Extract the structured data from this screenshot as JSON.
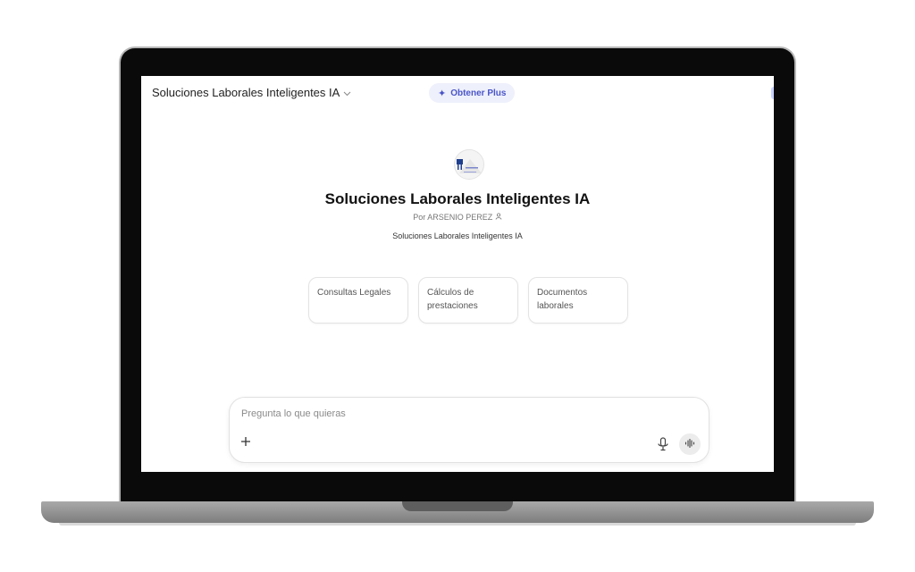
{
  "header": {
    "title": "Soluciones Laborales Inteligentes IA",
    "chevron": "chevron-down-icon",
    "plus_label": "Obtener Plus"
  },
  "profile": {
    "name": "Soluciones Laborales Inteligentes IA",
    "author": "Por ARSENIO PEREZ",
    "description": "Soluciones Laborales Inteligentes IA",
    "logo_icon": "gpt-logo"
  },
  "suggestions": [
    {
      "label": "Consultas Legales"
    },
    {
      "label": "Cálculos de prestaciones"
    },
    {
      "label": "Documentos laborales"
    }
  ],
  "composer": {
    "placeholder": "Pregunta lo que quieras",
    "add_icon": "plus-icon",
    "mic_icon": "microphone-icon",
    "voice_icon": "voice-mode-icon"
  },
  "colors": {
    "accent": "#4a55c8",
    "accent_bg": "#eef0fb"
  }
}
